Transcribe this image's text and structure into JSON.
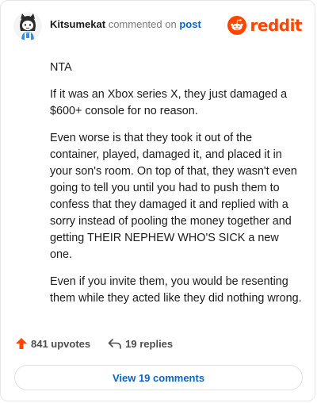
{
  "header": {
    "username": "Kitsumekat",
    "action": "commented on",
    "target": "post",
    "brand": "reddit",
    "brand_color": "#ff4500",
    "avatar_icon": "snoo-avatar-icon"
  },
  "comment": {
    "paragraphs": [
      "NTA",
      "If it was an Xbox series X, they just damaged a $600+ console for no reason.",
      "Even worse is that they took it out of the container, played, damaged it, and placed it in your son's room. On top of that, they wasn't even going to tell you until you had to push them to confess that they damaged it and replied with a sorry instead of pooling the money together and getting THEIR NEPHEW WHO'S SICK a new one.",
      "Even if you invite them, you would be resenting them while they acted like they did nothing wrong."
    ]
  },
  "footer": {
    "upvotes": "841 upvotes",
    "replies": "19 replies",
    "upvote_icon": "upvote-arrow-icon",
    "reply_icon": "reply-arrow-icon"
  },
  "view_button": {
    "label": "View 19 comments"
  },
  "colors": {
    "accent": "#ff4500",
    "link": "#0a65c9"
  }
}
